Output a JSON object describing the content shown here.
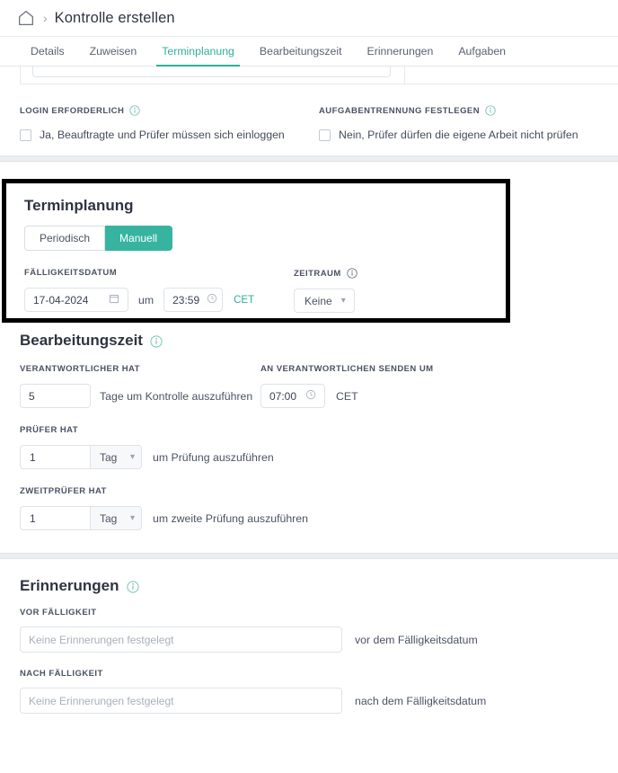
{
  "breadcrumb": {
    "home_icon": "home-icon",
    "separator": "›",
    "title": "Kontrolle erstellen"
  },
  "tabs": [
    {
      "label": "Details",
      "active": false
    },
    {
      "label": "Zuweisen",
      "active": false
    },
    {
      "label": "Terminplanung",
      "active": true
    },
    {
      "label": "Bearbeitungszeit",
      "active": false
    },
    {
      "label": "Erinnerungen",
      "active": false
    },
    {
      "label": "Aufgaben",
      "active": false
    }
  ],
  "login_section": {
    "left_label": "LOGIN ERFORDERLICH",
    "left_checkbox_text": "Ja, Beauftragte und Prüfer müssen sich einloggen",
    "right_label": "AUFGABENTRENNUNG FESTLEGEN",
    "right_checkbox_text": "Nein, Prüfer dürfen die eigene Arbeit nicht prüfen"
  },
  "terminplanung": {
    "heading": "Terminplanung",
    "mode_periodisch": "Periodisch",
    "mode_manuell": "Manuell",
    "selected_mode": "Manuell",
    "due_date_label": "FÄLLIGKEITSDATUM",
    "due_date_value": "17-04-2024",
    "um_label": "um",
    "time_value": "23:59",
    "timezone": "CET",
    "zeitraum_label": "ZEITRAUM",
    "zeitraum_value": "Keine"
  },
  "bearbeitungszeit": {
    "heading": "Bearbeitungszeit",
    "resp_label": "VERANTWORTLICHER HAT",
    "resp_days": "5",
    "resp_suffix": "Tage um Kontrolle auszuführen",
    "send_label": "AN VERANTWORTLICHEN SENDEN UM",
    "send_time": "07:00",
    "send_tz": "CET",
    "pruefer_label": "PRÜFER HAT",
    "pruefer_num": "1",
    "pruefer_unit": "Tag",
    "pruefer_suffix": "um Prüfung auszuführen",
    "zweit_label": "ZWEITPRÜFER HAT",
    "zweit_num": "1",
    "zweit_unit": "Tag",
    "zweit_suffix": "um zweite Prüfung auszuführen"
  },
  "erinnerungen": {
    "heading": "Erinnerungen",
    "vor_label": "VOR FÄLLIGKEIT",
    "vor_placeholder": "Keine Erinnerungen festgelegt",
    "vor_suffix": "vor dem Fälligkeitsdatum",
    "nach_label": "NACH FÄLLIGKEIT",
    "nach_placeholder": "Keine Erinnerungen festgelegt",
    "nach_suffix": "nach dem Fälligkeitsdatum"
  },
  "colors": {
    "accent": "#2fae9b",
    "accent_fill": "#36b4a0",
    "highlight_border": "#000000"
  }
}
